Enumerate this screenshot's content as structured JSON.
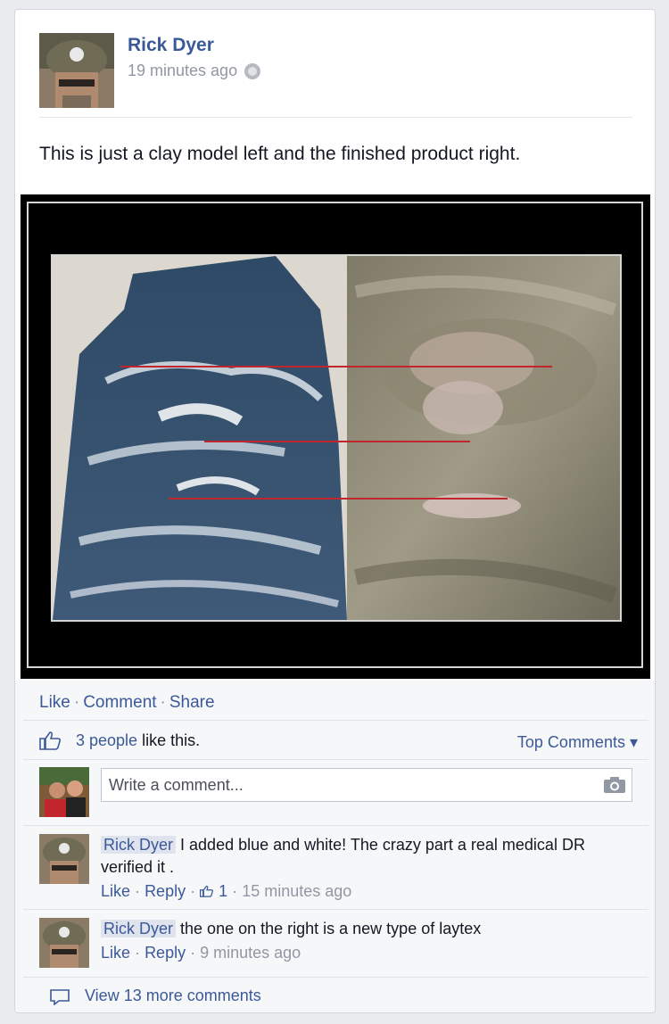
{
  "post": {
    "author": "Rick Dyer",
    "timestamp": "19 minutes ago",
    "text": "This is just a clay model left and the finished product right."
  },
  "actions": {
    "like": "Like",
    "comment": "Comment",
    "share": "Share",
    "separator": "·"
  },
  "likes": {
    "count_text": "3 people",
    "suffix": "like this.",
    "top_comments": "Top Comments ▾"
  },
  "composer": {
    "placeholder": "Write a comment..."
  },
  "comments": [
    {
      "author": "Rick Dyer",
      "text": "I added blue and white! The crazy part a real medical DR verified it .",
      "like": "Like",
      "reply": "Reply",
      "like_count": "1",
      "time": "15 minutes ago"
    },
    {
      "author": "Rick Dyer",
      "text": "the one on the right is a new type of laytex",
      "like": "Like",
      "reply": "Reply",
      "time": "9 minutes ago"
    }
  ],
  "view_more": "View 13 more comments",
  "colors": {
    "link": "#3b5998",
    "meta": "#9197a3",
    "feedback_bg": "#f6f7f9"
  }
}
